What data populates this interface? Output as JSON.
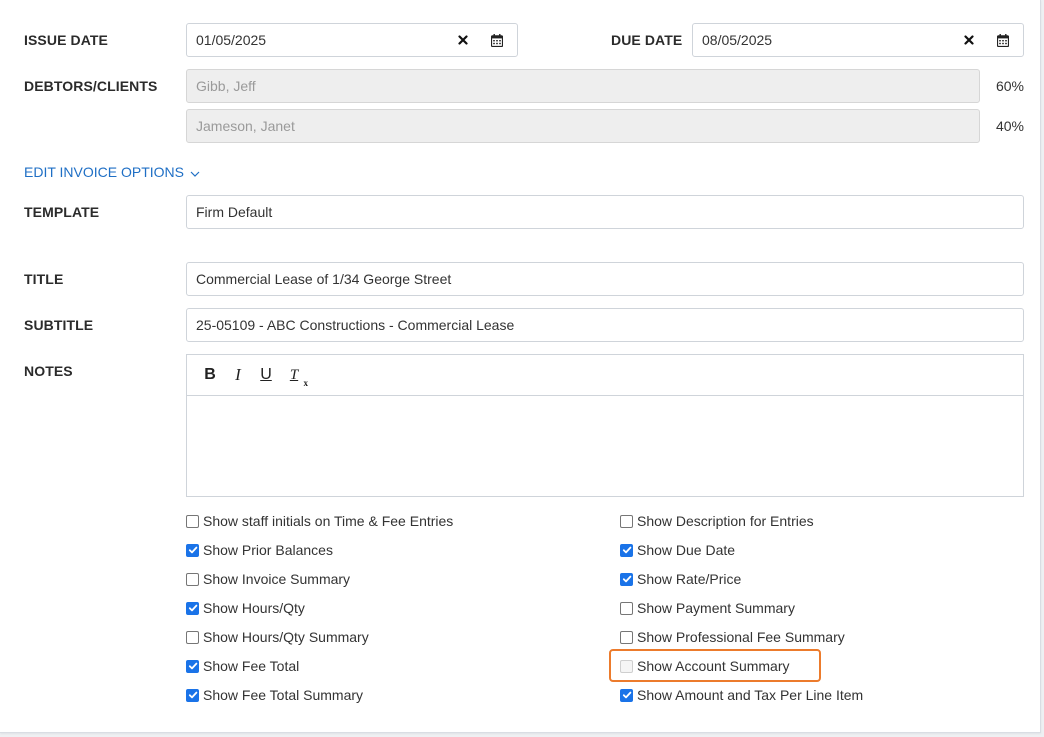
{
  "issue_date": {
    "label": "ISSUE DATE",
    "value": "01/05/2025"
  },
  "due_date": {
    "label": "DUE DATE",
    "value": "08/05/2025"
  },
  "debtors": {
    "label": "DEBTORS/CLIENTS",
    "items": [
      {
        "name": "Gibb, Jeff",
        "percent": "60%"
      },
      {
        "name": "Jameson, Janet",
        "percent": "40%"
      }
    ]
  },
  "edit_options_link": "EDIT INVOICE OPTIONS",
  "template": {
    "label": "TEMPLATE",
    "value": "Firm Default"
  },
  "title": {
    "label": "TITLE",
    "value": "Commercial Lease of 1/34 George Street"
  },
  "subtitle": {
    "label": "SUBTITLE",
    "value": "25-05109 - ABC Constructions - Commercial Lease"
  },
  "notes": {
    "label": "NOTES",
    "toolbar": {
      "bold": "B",
      "italic": "I",
      "underline": "U",
      "clear_format": "T"
    },
    "content": ""
  },
  "options_left": [
    {
      "label": "Show staff initials on Time & Fee Entries",
      "checked": false
    },
    {
      "label": "Show Prior Balances",
      "checked": true
    },
    {
      "label": "Show Invoice Summary",
      "checked": false
    },
    {
      "label": "Show Hours/Qty",
      "checked": true
    },
    {
      "label": "Show Hours/Qty Summary",
      "checked": false
    },
    {
      "label": "Show Fee Total",
      "checked": true
    },
    {
      "label": "Show Fee Total Summary",
      "checked": true
    }
  ],
  "options_right": [
    {
      "label": "Show Description for Entries",
      "checked": false
    },
    {
      "label": "Show Due Date",
      "checked": true
    },
    {
      "label": "Show Rate/Price",
      "checked": true
    },
    {
      "label": "Show Payment Summary",
      "checked": false
    },
    {
      "label": "Show Professional Fee Summary",
      "checked": false
    },
    {
      "label": "Show Account Summary",
      "checked": false,
      "disabled": true,
      "highlighted": true
    },
    {
      "label": "Show Amount and Tax Per Line Item",
      "checked": true
    }
  ],
  "colors": {
    "checkbox": "#1a73e8",
    "link": "#1f6fc5",
    "highlight": "#ec7b2c"
  },
  "icons": {
    "clear": "times-icon",
    "calendar": "calendar-icon",
    "chevron": "chevron-down-icon"
  }
}
